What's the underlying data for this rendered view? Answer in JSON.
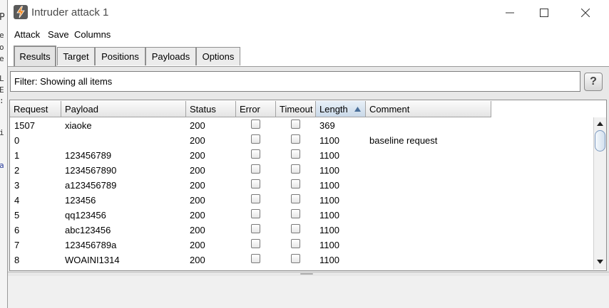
{
  "window": {
    "title": "Intruder attack 1"
  },
  "menu": [
    "Attack",
    "Save",
    "Columns"
  ],
  "tabs": [
    {
      "label": "Results",
      "active": true
    },
    {
      "label": "Target",
      "active": false
    },
    {
      "label": "Positions",
      "active": false
    },
    {
      "label": "Payloads",
      "active": false
    },
    {
      "label": "Options",
      "active": false
    }
  ],
  "filter": {
    "text": "Filter: Showing all items"
  },
  "help": {
    "label": "?"
  },
  "table": {
    "columns": [
      "Request",
      "Payload",
      "Status",
      "Error",
      "Timeout",
      "Length",
      "Comment"
    ],
    "sorted_column": "Length",
    "sort_direction": "ascending",
    "rows": [
      {
        "request": "1507",
        "payload": "xiaoke",
        "status": "200",
        "error": false,
        "timeout": false,
        "length": "369",
        "comment": ""
      },
      {
        "request": "0",
        "payload": "",
        "status": "200",
        "error": false,
        "timeout": false,
        "length": "1100",
        "comment": "baseline request"
      },
      {
        "request": "1",
        "payload": "123456789",
        "status": "200",
        "error": false,
        "timeout": false,
        "length": "1100",
        "comment": ""
      },
      {
        "request": "2",
        "payload": "1234567890",
        "status": "200",
        "error": false,
        "timeout": false,
        "length": "1100",
        "comment": ""
      },
      {
        "request": "3",
        "payload": "a123456789",
        "status": "200",
        "error": false,
        "timeout": false,
        "length": "1100",
        "comment": ""
      },
      {
        "request": "4",
        "payload": "123456",
        "status": "200",
        "error": false,
        "timeout": false,
        "length": "1100",
        "comment": ""
      },
      {
        "request": "5",
        "payload": "qq123456",
        "status": "200",
        "error": false,
        "timeout": false,
        "length": "1100",
        "comment": ""
      },
      {
        "request": "6",
        "payload": "abc123456",
        "status": "200",
        "error": false,
        "timeout": false,
        "length": "1100",
        "comment": ""
      },
      {
        "request": "7",
        "payload": "123456789a",
        "status": "200",
        "error": false,
        "timeout": false,
        "length": "1100",
        "comment": ""
      },
      {
        "request": "8",
        "payload": "WOAINI1314",
        "status": "200",
        "error": false,
        "timeout": false,
        "length": "1100",
        "comment": ""
      }
    ]
  },
  "background_window": {
    "fragments": [
      "P",
      "e",
      "o",
      "e",
      "L",
      "E",
      ":",
      "i",
      "a"
    ]
  },
  "colors": {
    "sorted_header": "#c9d8e8",
    "scroll_thumb_border": "#7c99bf"
  }
}
